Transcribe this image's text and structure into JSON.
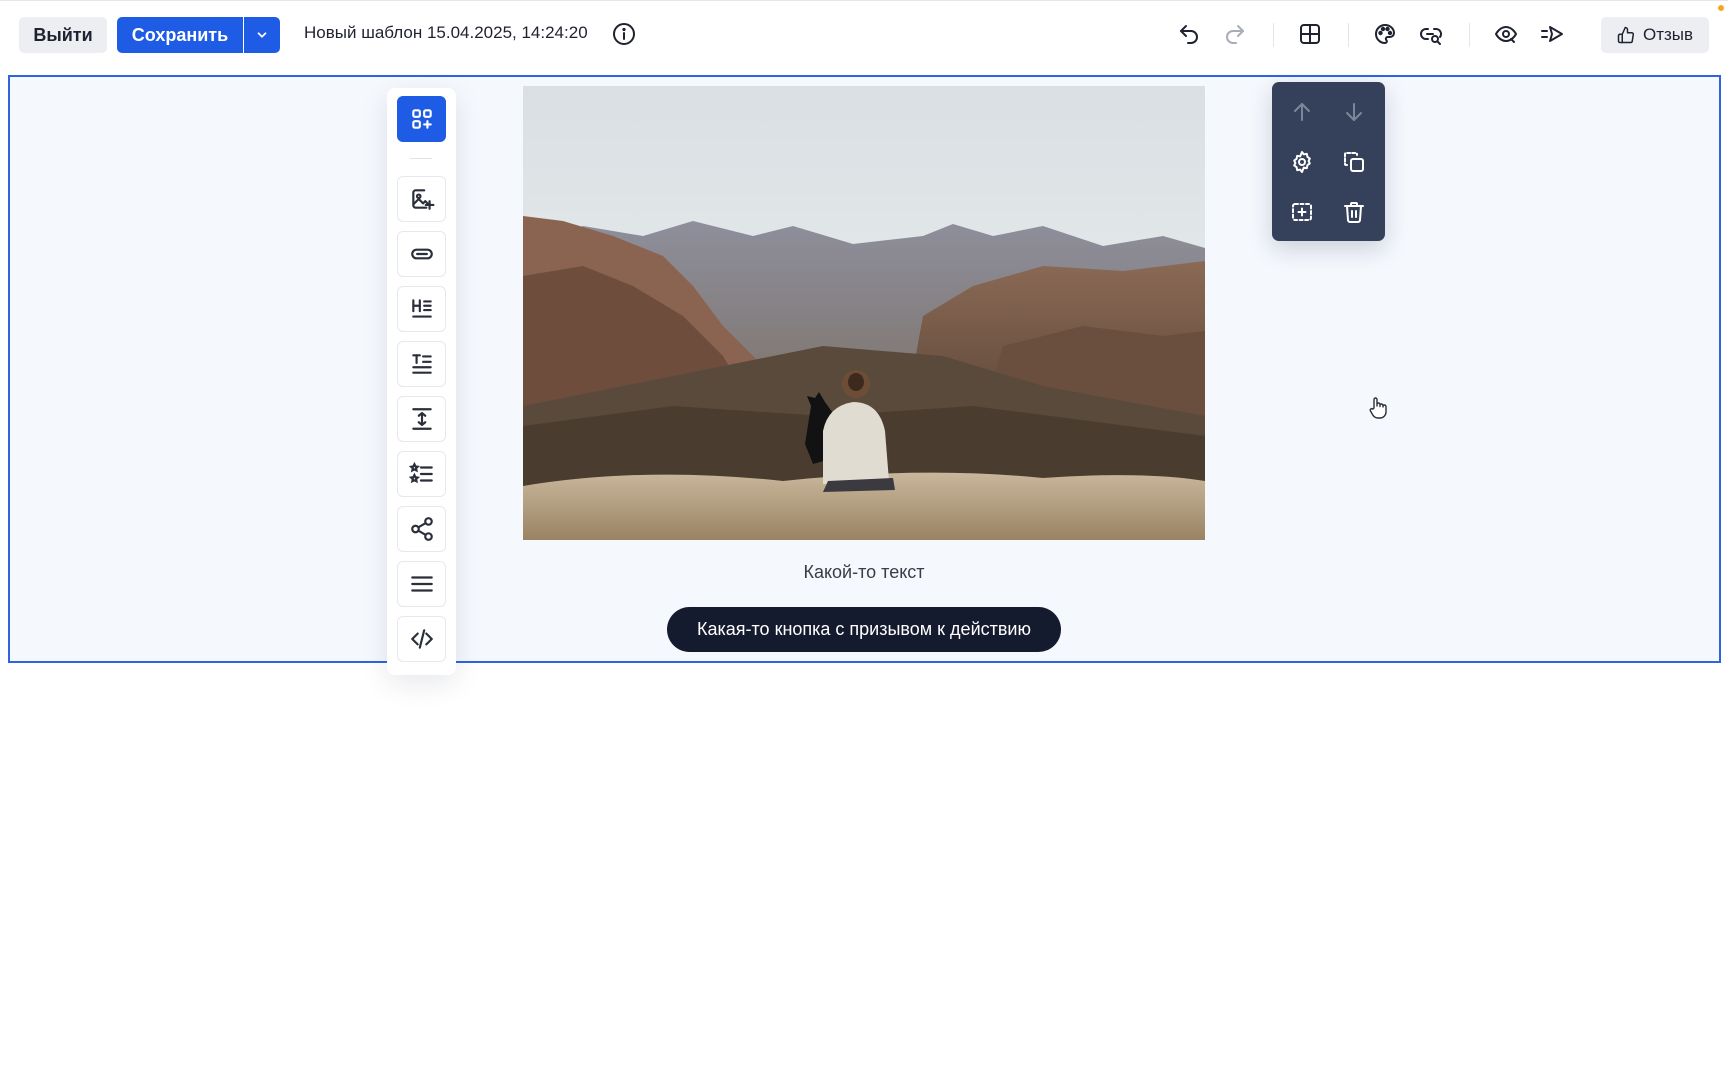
{
  "topbar": {
    "exit_label": "Выйти",
    "save_label": "Сохранить",
    "document_title": "Новый шаблон 15.04.2025, 14:24:20",
    "feedback_label": "Отзыв"
  },
  "toolbar_icons": [
    "undo-icon",
    "redo-icon",
    "layout-grid-icon",
    "palette-icon",
    "link-search-icon",
    "preview-eye-icon",
    "send-test-icon",
    "thumbs-up-icon"
  ],
  "tools_panel": {
    "items": [
      "add-block-icon",
      "image-add-icon",
      "button-icon",
      "heading-icon",
      "text-icon",
      "spacer-icon",
      "list-icon",
      "social-share-icon",
      "menu-icon",
      "code-icon"
    ]
  },
  "block_actions": {
    "items": [
      "move-up-icon",
      "move-down-icon",
      "settings-icon",
      "duplicate-icon",
      "add-inside-icon",
      "delete-icon"
    ]
  },
  "content": {
    "caption": "Какой-то текст",
    "cta_label": "Какая-то кнопка с призывом к действию"
  },
  "colors": {
    "primary": "#1e5ce6",
    "canvas_bg": "#f5f8fd",
    "selection_border": "#2f64de",
    "dark_panel": "#35405a",
    "cta_bg": "#151b2e"
  }
}
